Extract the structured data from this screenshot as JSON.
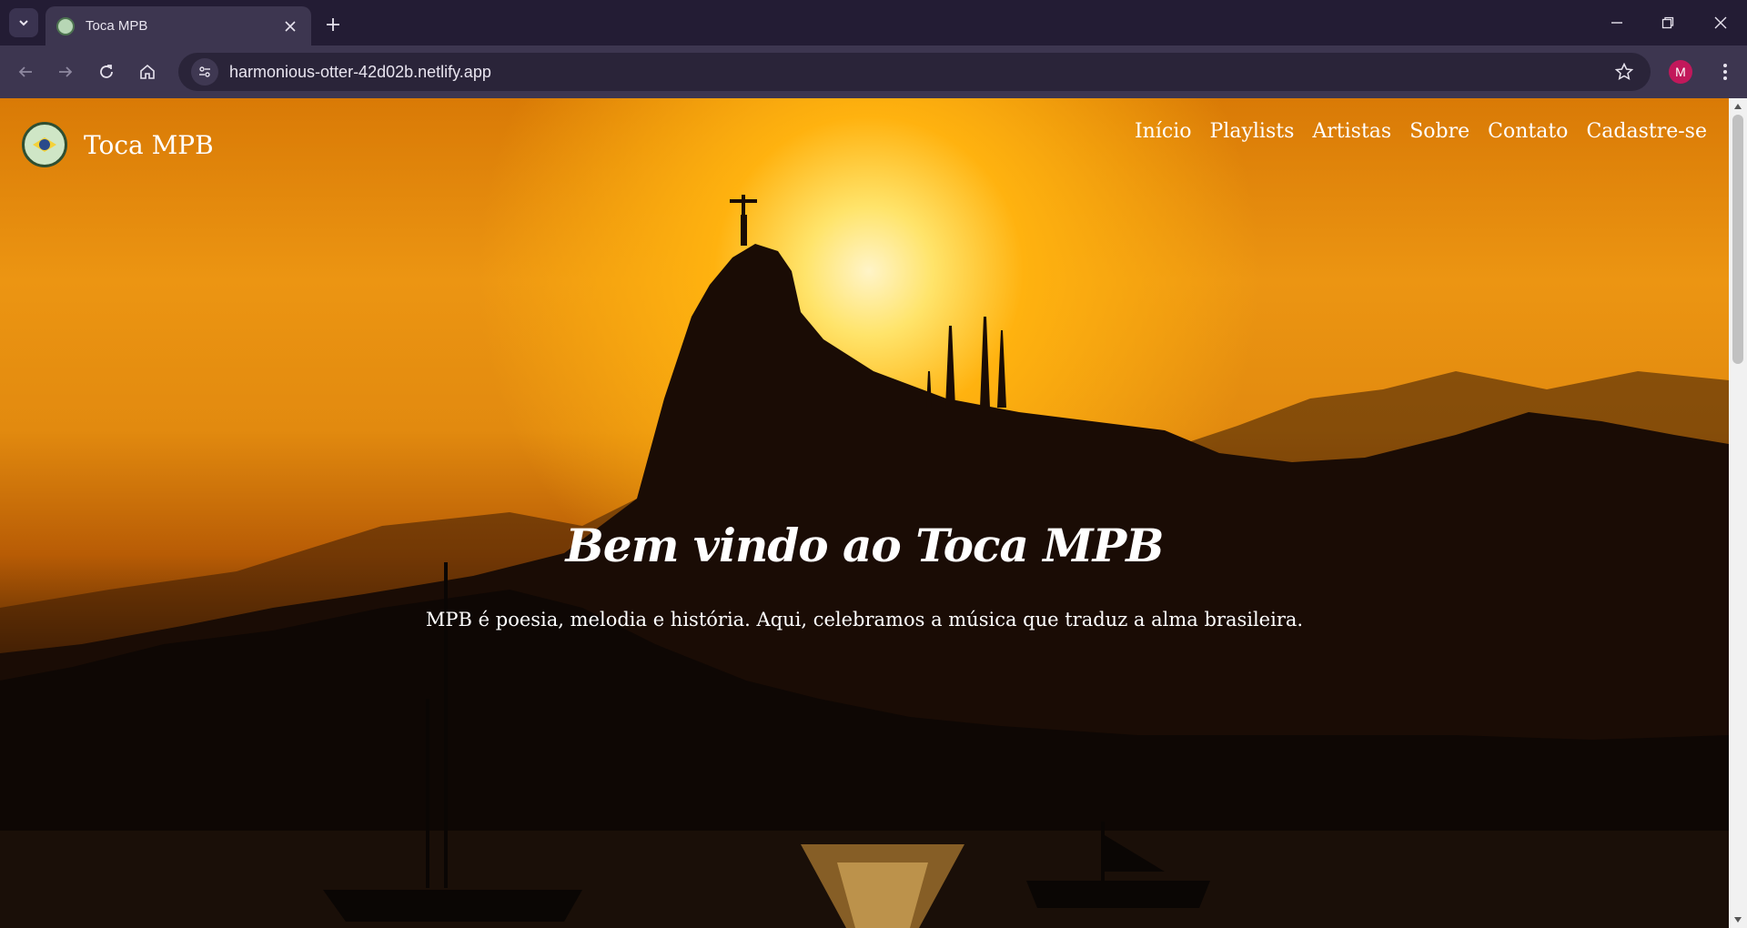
{
  "browser": {
    "tab_title": "Toca MPB",
    "url": "harmonious-otter-42d02b.netlify.app",
    "profile_initial": "M"
  },
  "site": {
    "brand": "Toca MPB",
    "nav": [
      "Início",
      "Playlists",
      "Artistas",
      "Sobre",
      "Contato",
      "Cadastre-se"
    ],
    "hero_title": "Bem vindo ao Toca MPB",
    "hero_subtitle": "MPB é poesia, melodia e história. Aqui, celebramos a música que traduz a alma brasileira."
  },
  "colors": {
    "sky_orange": "#e28a0f",
    "sun": "#fff4c8",
    "silhouette": "#0c0705",
    "profile": "#c2185b"
  }
}
